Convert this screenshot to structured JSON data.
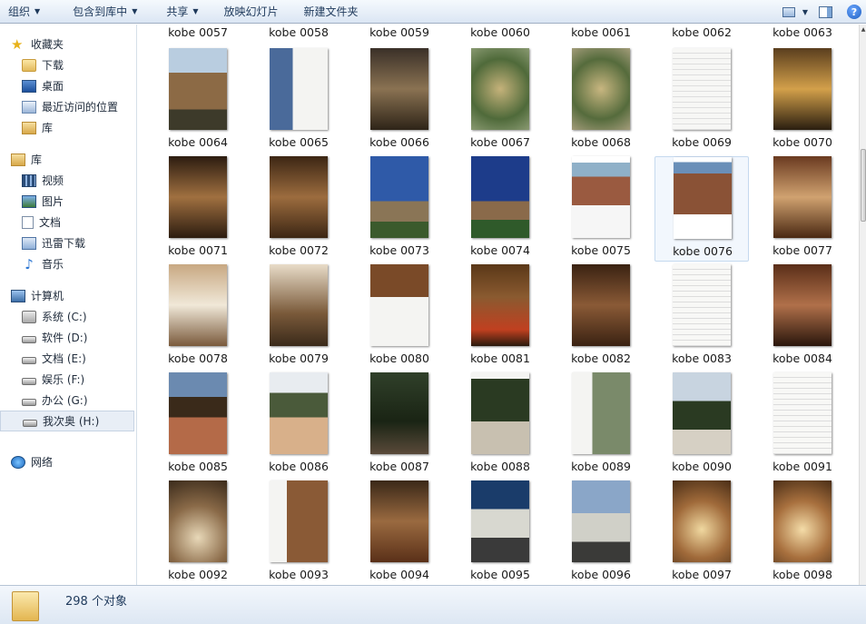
{
  "toolbar": {
    "organize": "组织",
    "include_library": "包含到库中",
    "share": "共享",
    "slideshow": "放映幻灯片",
    "new_folder": "新建文件夹",
    "help": "?"
  },
  "nav": {
    "favorites": {
      "label": "收藏夹",
      "items": [
        {
          "label": "下载",
          "icon": "download-folder-icon"
        },
        {
          "label": "桌面",
          "icon": "desktop-icon"
        },
        {
          "label": "最近访问的位置",
          "icon": "recent-places-icon"
        },
        {
          "label": "库",
          "icon": "library-icon"
        }
      ]
    },
    "libraries": {
      "label": "库",
      "items": [
        {
          "label": "视频",
          "icon": "video-icon"
        },
        {
          "label": "图片",
          "icon": "pictures-icon"
        },
        {
          "label": "文档",
          "icon": "documents-icon"
        },
        {
          "label": "迅雷下载",
          "icon": "thunder-download-icon"
        },
        {
          "label": "音乐",
          "icon": "music-icon"
        }
      ]
    },
    "computer": {
      "label": "计算机",
      "items": [
        {
          "label": "系统 (C:)",
          "icon": "system-drive-icon"
        },
        {
          "label": "软件 (D:)",
          "icon": "drive-icon"
        },
        {
          "label": "文档 (E:)",
          "icon": "drive-icon"
        },
        {
          "label": "娱乐 (F:)",
          "icon": "drive-icon"
        },
        {
          "label": "办公 (G:)",
          "icon": "drive-icon"
        },
        {
          "label": "我次奥 (H:)",
          "icon": "drive-icon",
          "selected": true
        }
      ]
    },
    "network": {
      "label": "网络"
    }
  },
  "files": {
    "top_row": [
      "kobe 0057",
      "kobe 0058",
      "kobe 0059",
      "kobe 0060",
      "kobe 0061",
      "kobe 0062",
      "kobe 0063"
    ],
    "rows": [
      [
        "kobe 0064",
        "kobe 0065",
        "kobe 0066",
        "kobe 0067",
        "kobe 0068",
        "kobe 0069",
        "kobe 0070"
      ],
      [
        "kobe 0071",
        "kobe 0072",
        "kobe 0073",
        "kobe 0074",
        "kobe 0075",
        "kobe 0076",
        "kobe 0077"
      ],
      [
        "kobe 0078",
        "kobe 0079",
        "kobe 0080",
        "kobe 0081",
        "kobe 0082",
        "kobe 0083",
        "kobe 0084"
      ],
      [
        "kobe 0085",
        "kobe 0086",
        "kobe 0087",
        "kobe 0088",
        "kobe 0089",
        "kobe 0090",
        "kobe 0091"
      ],
      [
        "kobe 0092",
        "kobe 0093",
        "kobe 0094",
        "kobe 0095",
        "kobe 0096",
        "kobe 0097",
        "kobe 0098"
      ]
    ],
    "selected": "kobe 0076"
  },
  "status": {
    "count": "298 个对象"
  }
}
